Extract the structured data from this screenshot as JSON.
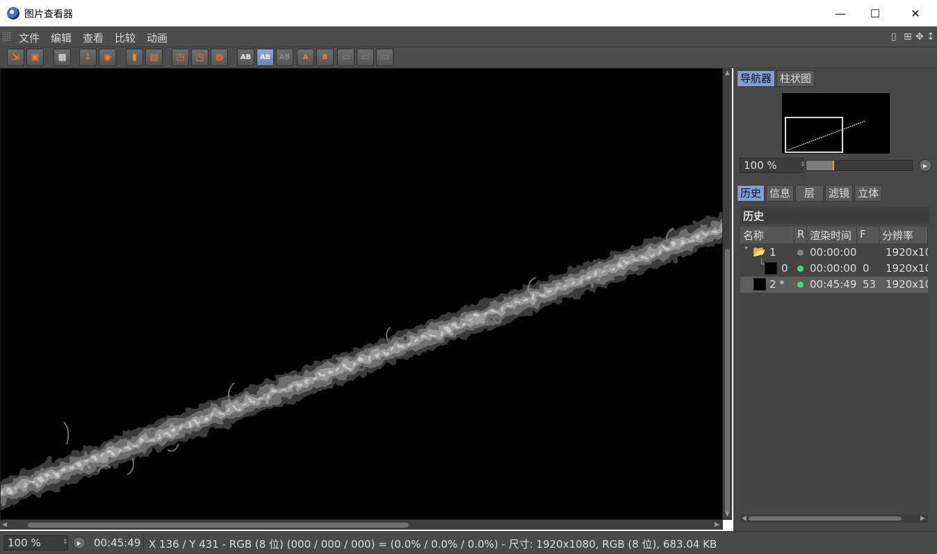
{
  "window": {
    "title": "图片查看器",
    "minimize": "—",
    "maximize": "☐",
    "close": "✕"
  },
  "menu": {
    "items": [
      "文件",
      "编辑",
      "查看",
      "比较",
      "动画"
    ],
    "right_icons": [
      "panel-icon",
      "plus-box-icon",
      "move-icon",
      "arrow-icon"
    ]
  },
  "toolbar": {
    "buttons": [
      {
        "icon": "open-folder-icon",
        "glyph": "📂"
      },
      {
        "icon": "save-icon",
        "glyph": "💾"
      },
      {
        "icon": "film-grid-icon",
        "glyph": "▦"
      },
      {
        "icon": "export-grid-icon",
        "glyph": "⇩"
      },
      {
        "icon": "user-export-icon",
        "glyph": "⇩"
      },
      {
        "icon": "delete-icon",
        "glyph": "▮"
      },
      {
        "icon": "delete-all-icon",
        "glyph": "▮"
      },
      {
        "icon": "view-a-icon",
        "glyph": "◳"
      },
      {
        "icon": "view-b-icon",
        "glyph": "◳"
      },
      {
        "icon": "channels-icon",
        "glyph": "◍"
      },
      {
        "icon": "ab-compare-icon",
        "glyph": "AB"
      },
      {
        "icon": "ab-split-icon",
        "glyph": "AB"
      },
      {
        "icon": "ab-toggle-icon",
        "glyph": "AB"
      },
      {
        "icon": "set-a-icon",
        "glyph": "A"
      },
      {
        "icon": "set-b-icon",
        "glyph": "B"
      },
      {
        "icon": "layout-1-icon",
        "glyph": "▭"
      },
      {
        "icon": "layout-2-icon",
        "glyph": "▭"
      },
      {
        "icon": "layout-3-icon",
        "glyph": "▭"
      }
    ]
  },
  "right_panel": {
    "top_tabs": [
      "导航器",
      "柱状图"
    ],
    "zoom": "100 %",
    "slider_fraction": 0.25,
    "lower_tabs": [
      "历史",
      "信息",
      "层",
      "滤镜",
      "立体"
    ],
    "section_title": "历史",
    "columns": [
      "名称",
      "R",
      "渲染时间",
      "F",
      "分辨率"
    ],
    "rows": [
      {
        "name": "1",
        "r_color": "#808080",
        "time": "00:00:00",
        "frames": "",
        "res": "1920x10"
      },
      {
        "name": "0",
        "r_color": "#3ddc84",
        "time": "00:00:00",
        "frames": "0",
        "res": "1920x10"
      },
      {
        "name": "2 *",
        "r_color": "#3ddc84",
        "time": "00:45:49",
        "frames": "53",
        "res": "1920x10"
      }
    ]
  },
  "status": {
    "zoom": "100 %",
    "time": "00:45:49",
    "info": "X 136 / Y 431 - RGB (8 位) (000 / 000 / 000) = (0.0% / 0.0% / 0.0%) - 尺寸: 1920x1080, RGB (8 位), 683.04 KB"
  }
}
